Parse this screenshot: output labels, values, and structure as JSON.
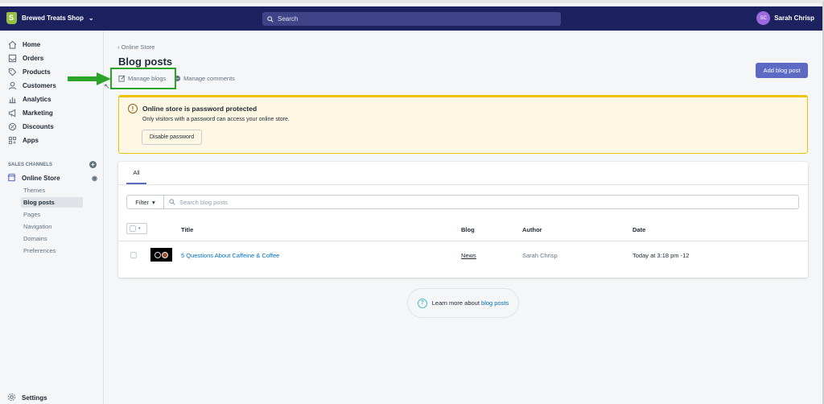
{
  "topbar": {
    "store_name": "Brewed Treats Shop",
    "search_placeholder": "Search",
    "user_initials": "SC",
    "user_name": "Sarah Chrisp"
  },
  "sidebar": {
    "items": [
      {
        "label": "Home",
        "icon": "home-icon"
      },
      {
        "label": "Orders",
        "icon": "orders-icon"
      },
      {
        "label": "Products",
        "icon": "tag-icon"
      },
      {
        "label": "Customers",
        "icon": "person-icon"
      },
      {
        "label": "Analytics",
        "icon": "chart-icon"
      },
      {
        "label": "Marketing",
        "icon": "megaphone-icon"
      },
      {
        "label": "Discounts",
        "icon": "discount-icon"
      },
      {
        "label": "Apps",
        "icon": "apps-icon"
      }
    ],
    "channels_heading": "SALES CHANNELS",
    "online_store": "Online Store",
    "sub_items": [
      "Themes",
      "Blog posts",
      "Pages",
      "Navigation",
      "Domains",
      "Preferences"
    ],
    "settings": "Settings"
  },
  "main": {
    "breadcrumb": "Online Store",
    "title": "Blog posts",
    "manage_blogs": "Manage blogs",
    "manage_comments": "Manage comments",
    "add_button": "Add blog post"
  },
  "banner": {
    "title": "Online store is password protected",
    "text": "Only visitors with a password can access your online store.",
    "button": "Disable password",
    "color": "#eec200"
  },
  "table": {
    "tab": "All",
    "filter_label": "Filter",
    "search_placeholder": "Search blog posts",
    "headers": [
      "Title",
      "Blog",
      "Author",
      "Date"
    ],
    "rows": [
      {
        "title": "5 Questions About Caffeine & Coffee",
        "blog": "News",
        "author": "Sarah Chrisp",
        "date": "Today at 3:18 pm -12"
      }
    ]
  },
  "learn": {
    "text": "Learn more about",
    "link": "blog posts"
  },
  "colors": {
    "topbar": "#1c2260",
    "accent": "#5c6ac4",
    "link": "#006fbb",
    "highlight": "#2aa52a"
  }
}
